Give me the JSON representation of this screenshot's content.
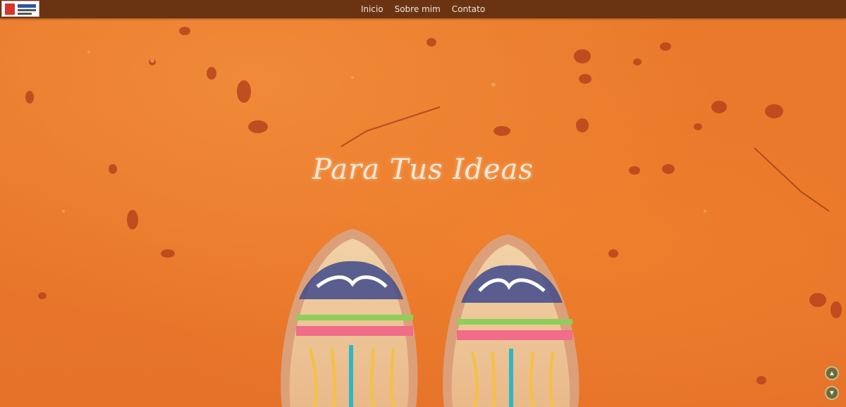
{
  "nav": {
    "items": [
      {
        "label": "Inicio"
      },
      {
        "label": "Sobre mim"
      },
      {
        "label": "Contato"
      }
    ]
  },
  "hero": {
    "title": "Para Tus Ideas"
  },
  "colors": {
    "topbar": "#6a3412",
    "background": "#e8772a",
    "title": "#fbe9d6",
    "float_buttons": "#6d6a3c"
  },
  "icons": {
    "logo": "brand-logo",
    "scroll_up": "chevron-up-icon",
    "scroll_down": "chevron-down-icon"
  }
}
